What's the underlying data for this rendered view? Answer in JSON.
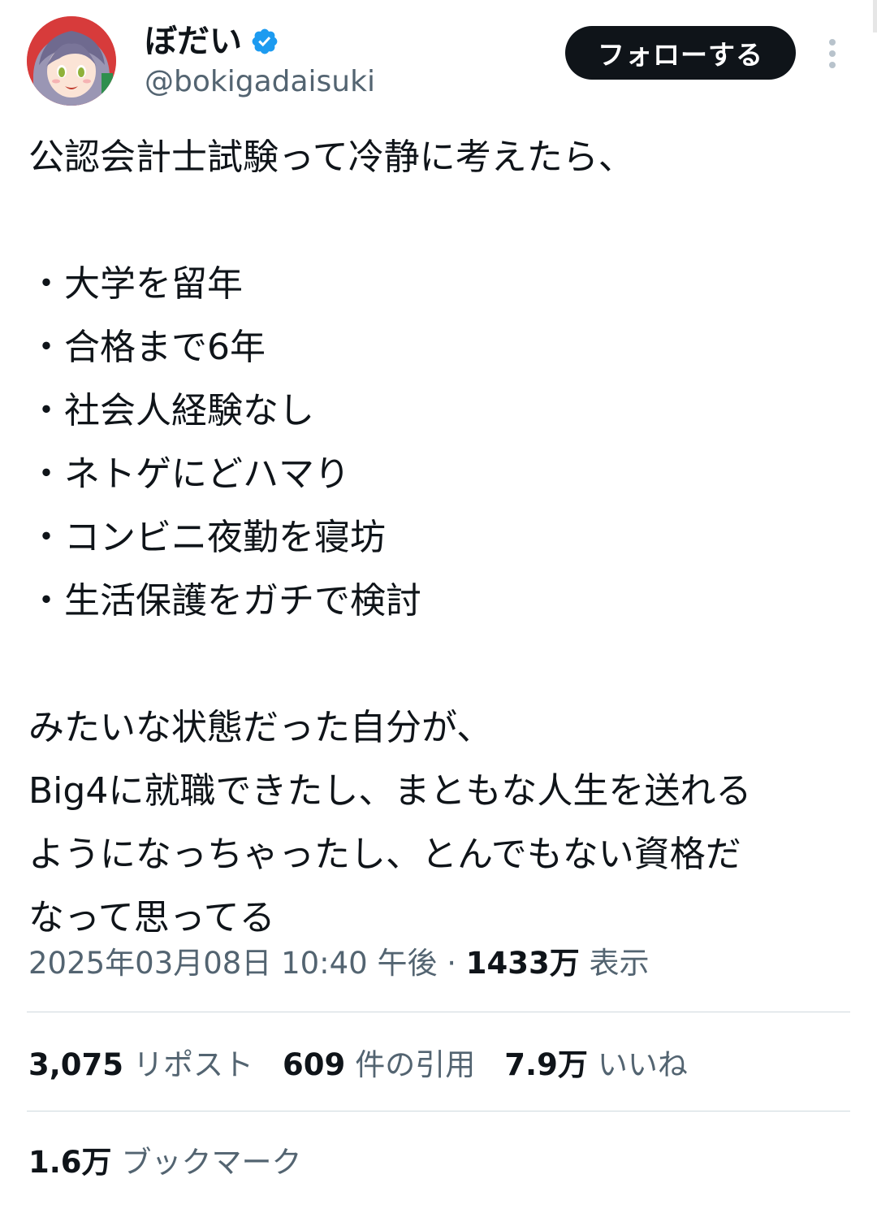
{
  "author": {
    "display_name": "ぼだい",
    "handle": "@bokigadaisuki",
    "verified": true
  },
  "actions": {
    "follow_label": "フォローする"
  },
  "tweet": {
    "text": "公認会計士試験って冷静に考えたら、\n\n・大学を留年\n・合格まで6年\n・社会人経験なし\n・ネトゲにどハマり\n・コンビニ夜勤を寝坊\n・生活保護をガチで検討\n\nみたいな状態だった自分が、\nBig4に就職できたし、まともな人生を送れる\nようになっちゃったし、とんでもない資格だ\nなって思ってる"
  },
  "meta": {
    "timestamp": "2025年03月08日 10:40 午後",
    "separator": "·",
    "views_count": "1433万",
    "views_label": "表示"
  },
  "stats": {
    "reposts_count": "3,075",
    "reposts_label": "リポスト",
    "quotes_count": "609",
    "quotes_label": "件の引用",
    "likes_count": "7.9万",
    "likes_label": "いいね",
    "bookmarks_count": "1.6万",
    "bookmarks_label": "ブックマーク"
  },
  "colors": {
    "text_primary": "#0f1419",
    "text_secondary": "#536471",
    "verified_blue": "#1d9bf0",
    "button_bg": "#0f1419",
    "divider": "#cfd9de"
  },
  "icons": {
    "verified": "verified-badge-icon",
    "more": "more-vertical-icon"
  }
}
